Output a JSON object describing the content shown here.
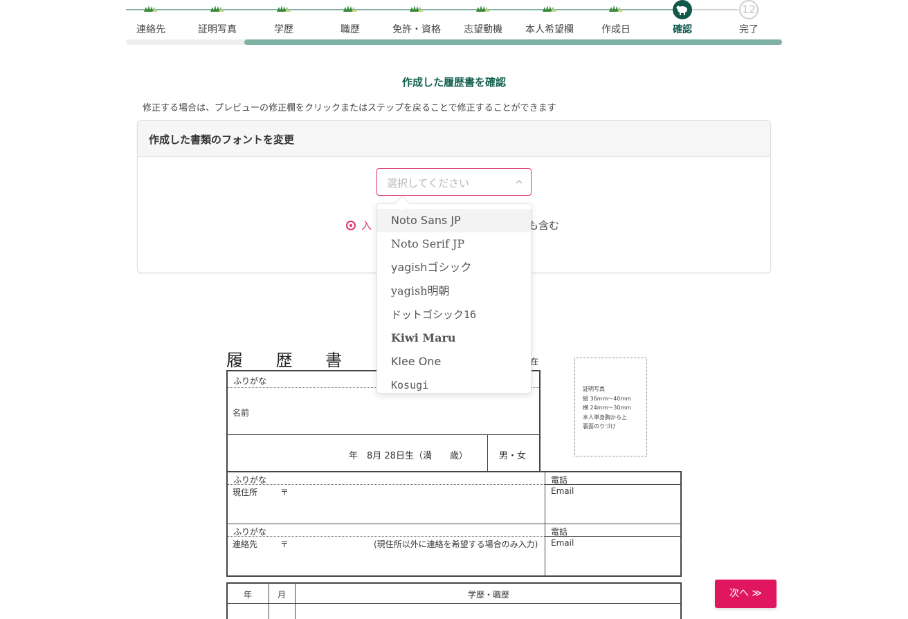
{
  "stepper": {
    "steps": [
      {
        "label": "連絡先",
        "state": "done"
      },
      {
        "label": "証明写真",
        "state": "done"
      },
      {
        "label": "学歴",
        "state": "done"
      },
      {
        "label": "職歴",
        "state": "done"
      },
      {
        "label": "免許・資格",
        "state": "done"
      },
      {
        "label": "志望動機",
        "state": "done"
      },
      {
        "label": "本人希望欄",
        "state": "done"
      },
      {
        "label": "作成日",
        "state": "done"
      },
      {
        "label": "確認",
        "state": "current"
      },
      {
        "label": "完了",
        "state": "future",
        "number": "12"
      }
    ],
    "progress_fraction": 0.82
  },
  "heading": {
    "title": "作成した履歴書を確認",
    "description": "修正する場合は、プレビューの修正欄をクリックまたはステップを戻ることで修正することができます"
  },
  "font_card": {
    "header": "作成した書類のフォントを変更",
    "select_placeholder": "選択してください",
    "radio_prefix": "入",
    "radio_suffix": "も含む"
  },
  "dropdown": {
    "options": [
      "Noto Sans JP",
      "Noto Serif JP",
      "yagishゴシック",
      "yagish明朝",
      "ドットゴシック16",
      "Kiwi Maru",
      "Klee One",
      "Kosugi"
    ],
    "highlighted_index": 0
  },
  "resume": {
    "title": "履 歴 書",
    "as_of": "在",
    "furigana": "ふりがな",
    "name_label": "名前",
    "birth_text": "年　8月 28日生（満　　歳）",
    "gender_text": "男・女",
    "photo_lines": [
      "証明写真",
      "縦 36mm〜40mm",
      "横 24mm〜30mm",
      "本人単身胸から上",
      "裏面のりづけ"
    ],
    "address_furigana": "ふりがな",
    "address_label": "現住所",
    "postal_mark": "〒",
    "phone_label": "電話",
    "email_label": "Email",
    "contact_furigana": "ふりがな",
    "contact_label": "連絡先",
    "contact_postal_mark": "〒",
    "contact_note": "(現住所以外に連絡を希望する場合のみ入力)",
    "contact_phone_label": "電話",
    "contact_email_label": "Email",
    "history_headers": [
      "年",
      "月",
      "学歴・職歴"
    ]
  },
  "next_button": {
    "label": "次へ ≫"
  },
  "colors": {
    "accent_green": "#11574a",
    "accent_pink": "#e0175f",
    "progress": "#7fb1a5"
  }
}
